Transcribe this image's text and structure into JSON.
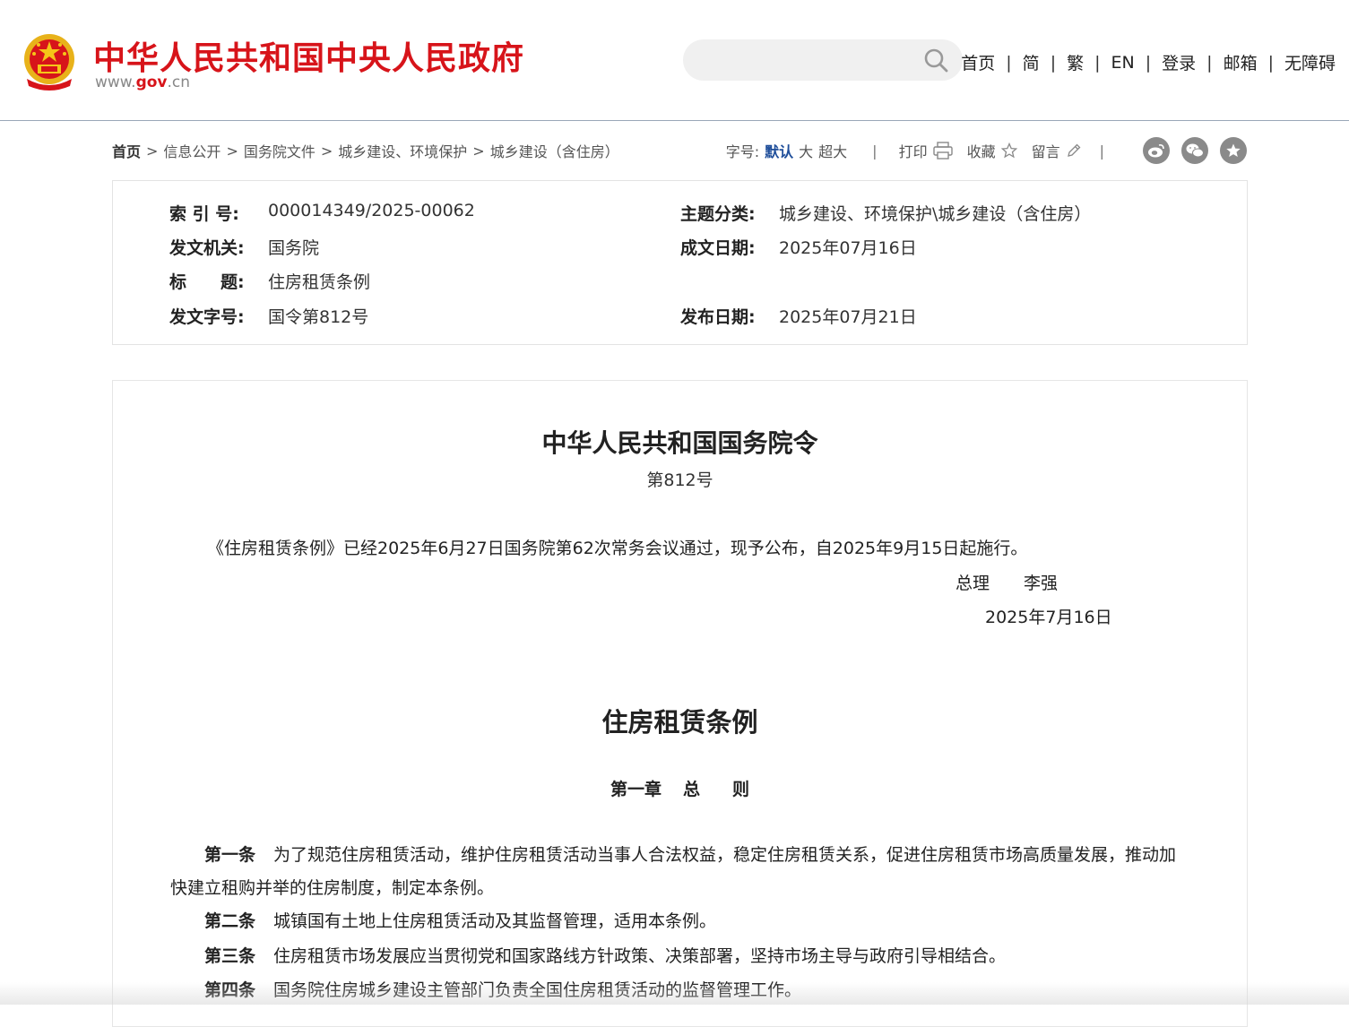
{
  "header": {
    "site_title": "中华人民共和国中央人民政府",
    "site_url_prefix": "www.",
    "site_url_domain": "gov",
    "site_url_suffix": ".cn",
    "search_placeholder": "",
    "nav": [
      "首页",
      "简",
      "繁",
      "EN",
      "登录",
      "邮箱",
      "无障碍"
    ],
    "nav_separator": "|",
    "brand_color": "#d7141a"
  },
  "breadcrumb": {
    "items": [
      "首页",
      "信息公开",
      "国务院文件",
      "城乡建设、环境保护",
      "城乡建设（含住房）"
    ],
    "separator": ">"
  },
  "tools": {
    "font_size_label": "字号:",
    "font_size_options": [
      "默认",
      "大",
      "超大"
    ],
    "font_size_selected": "默认",
    "print_label": "打印",
    "favorite_label": "收藏",
    "comment_label": "留言",
    "separator": "|",
    "share_icons": [
      "weibo-icon",
      "wechat-icon",
      "favorite-star-icon"
    ]
  },
  "info": {
    "index_no_label": "索 引 号:",
    "index_no": "000014349/2025-00062",
    "topic_label": "主题分类:",
    "topic": "城乡建设、环境保护\\城乡建设（含住房）",
    "issuer_label": "发文机关:",
    "issuer": "国务院",
    "written_date_label": "成文日期:",
    "written_date": "2025年07月16日",
    "title_label": "标　　题:",
    "title": "住房租赁条例",
    "doc_no_label": "发文字号:",
    "doc_no": "国令第812号",
    "publish_date_label": "发布日期:",
    "publish_date": "2025年07月21日"
  },
  "article": {
    "order_title": "中华人民共和国国务院令",
    "order_no": "第812号",
    "promulgation": "《住房租赁条例》已经2025年6月27日国务院第62次常务会议通过，现予公布，自2025年9月15日起施行。",
    "signer_role": "总理",
    "signer_name": "李强",
    "sign_date": "2025年7月16日",
    "regulation_title": "住房租赁条例",
    "chapter_no": "第一章",
    "chapter_name_1": "总",
    "chapter_name_2": "则",
    "articles": [
      {
        "num": "第一条",
        "text": "为了规范住房租赁活动，维护住房租赁活动当事人合法权益，稳定住房租赁关系，促进住房租赁市场高质量发展，推动加快建立租购并举的住房制度，制定本条例。"
      },
      {
        "num": "第二条",
        "text": "城镇国有土地上住房租赁活动及其监督管理，适用本条例。"
      },
      {
        "num": "第三条",
        "text": "住房租赁市场发展应当贯彻党和国家路线方针政策、决策部署，坚持市场主导与政府引导相结合。"
      },
      {
        "num": "第四条",
        "text": "国务院住房城乡建设主管部门负责全国住房租赁活动的监督管理工作。"
      }
    ]
  }
}
